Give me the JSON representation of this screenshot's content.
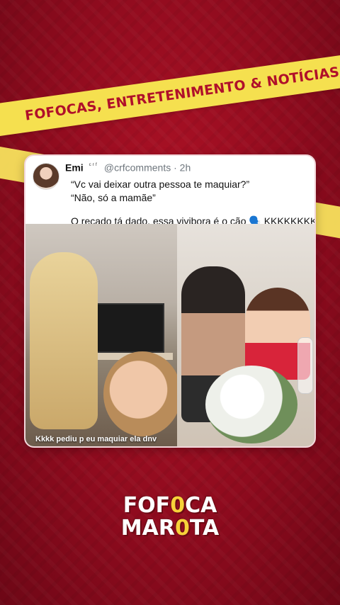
{
  "banner": {
    "text": "FOFOCAS, ENTRETENIMENTO & NOTÍCIAS"
  },
  "tweet": {
    "author_name": "Emi",
    "author_badge": "ᶜʳᶠ",
    "handle_time": "@crfcomments · 2h",
    "lines": [
      "“Vc vai deixar outra pessoa te maquiar?”",
      "“Não, só a mamãe”",
      "O recado tá dado, essa vivibora é o cão 🗣️ KKKKKKKK"
    ]
  },
  "media": {
    "left_caption": "Kkkk pediu p eu maquiar ela dnv"
  },
  "logo": {
    "line1_a": "FOF",
    "line1_b": "0",
    "line1_c": "CA",
    "line2_a": "MAR",
    "line2_b": "0",
    "line2_c": "TA"
  },
  "colors": {
    "background": "#a10f22",
    "banner": "#f5e04f",
    "banner_text": "#b0102a"
  }
}
